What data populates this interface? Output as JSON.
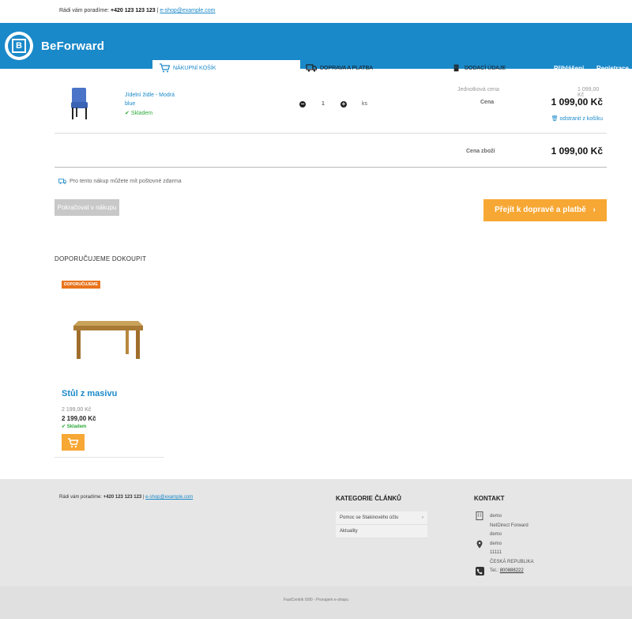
{
  "topbar": {
    "lead": "Rádi vám poradíme:",
    "phone": "+420 123 123 123",
    "separator": "|",
    "email": "e-shop@example.com"
  },
  "header": {
    "logo_text": "BeForward",
    "steps": [
      {
        "label": "NÁKUPNÍ KOŠÍK",
        "icon": "cart-icon"
      },
      {
        "label": "DOPRAVA A PLATBA",
        "icon": "truck-icon"
      },
      {
        "label": "DODACÍ ÚDAJE",
        "icon": "building-icon"
      }
    ],
    "login": "Přihlášení",
    "register": "Registrace"
  },
  "cart": {
    "item": {
      "name": "Jídelní židle - Modrá",
      "color": "blue",
      "stock": "Skladem",
      "qty": "1",
      "unit": "ks",
      "unit_price_label": "Jednotková cena",
      "unit_price": "1 099,00 Kč",
      "price_label": "Cena",
      "price": "1 099,00 Kč",
      "remove_label": "odstranit z košíku"
    },
    "subtotal_label": "Cena zboží",
    "subtotal": "1 099,00 Kč",
    "free_shipping": "Pro tento nákup můžete mít poštovné zdarma",
    "continue_label": "Pokračovat v nákupu",
    "proceed_label": "Přejít k dopravě a platbě"
  },
  "recommend": {
    "title": "DOPORUČUJEME DOKOUPIT",
    "badge": "DOPORUČUJEME",
    "product": {
      "name": "Stůl z masivu",
      "old_price": "2 199,00 Kč",
      "price": "2 199,00 Kč",
      "stock": "Skladem"
    }
  },
  "footer": {
    "contact_lead": "Rádi vám poradíme:",
    "phone": "+420 123 123 123",
    "separator": "|",
    "email": "e-shop@example.com",
    "categories_title": "KATEGORIE ČLÁNKŮ",
    "categories": [
      "Pomoc se Stakinového účtu",
      "Aktuality"
    ],
    "contact_title": "KONTAKT",
    "address_lines": [
      "demo",
      "NetDirect Forward",
      "demo",
      "demo",
      "11111",
      "ČESKÁ REPUBLIKA"
    ],
    "tel_label": "Tel.:",
    "tel_value": "800888222"
  },
  "credits": "FastCentrik 6/90 - Pronajem e-shopu",
  "colors": {
    "brand_blue": "#1a89c9",
    "cta_orange": "#f7a733",
    "stock_green": "#2eaa3a",
    "badge_orange": "#e8741e"
  }
}
